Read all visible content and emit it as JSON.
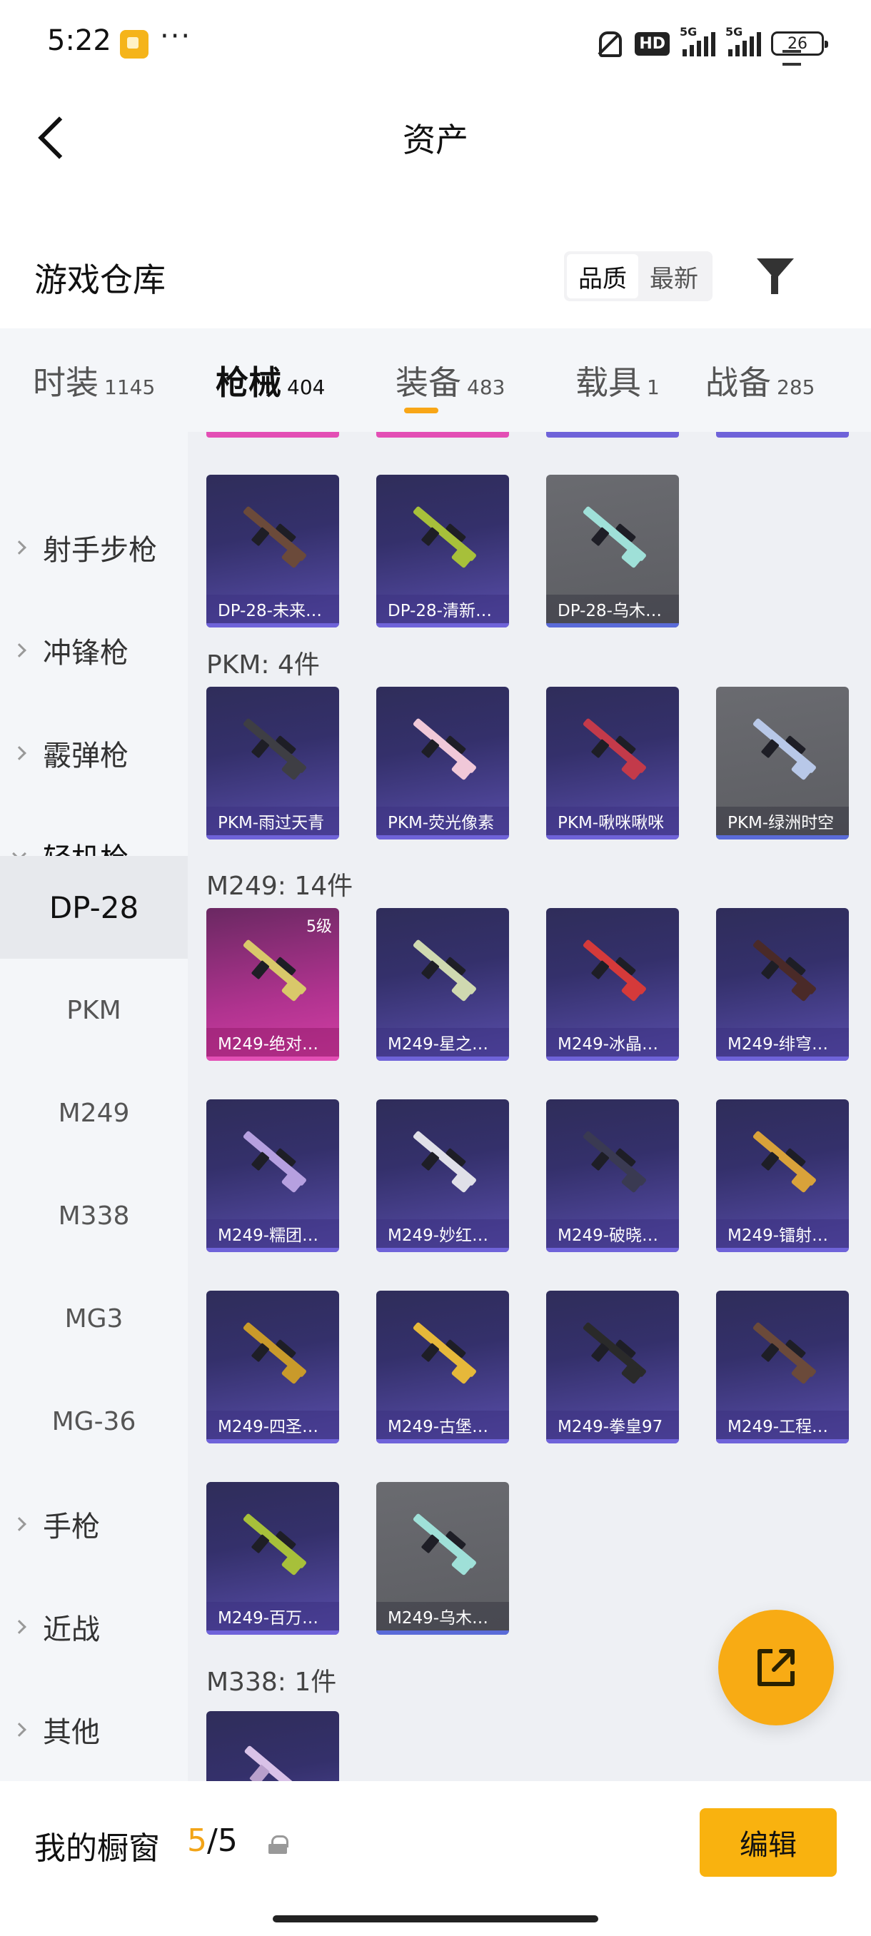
{
  "status": {
    "time": "5:22",
    "more": "···",
    "hd": "HD",
    "net1": "5G",
    "net2": "5G",
    "battery": "26"
  },
  "header": {
    "title": "资产"
  },
  "warehouse": {
    "title": "游戏仓库",
    "sort_quality": "品质",
    "sort_newest": "最新"
  },
  "categories": [
    {
      "label": "时装",
      "count": "1145"
    },
    {
      "label": "枪械",
      "count": "404",
      "active": true
    },
    {
      "label": "装备",
      "count": "483"
    },
    {
      "label": "载具",
      "count": "1"
    },
    {
      "label": "战备",
      "count": "285"
    }
  ],
  "sidebar": {
    "groups": [
      {
        "label": "射手步枪"
      },
      {
        "label": "冲锋枪"
      },
      {
        "label": "霰弹枪"
      },
      {
        "label": "轻机枪",
        "expanded": true
      },
      {
        "label": "手枪"
      },
      {
        "label": "近战"
      },
      {
        "label": "其他"
      }
    ],
    "subitems": [
      "DP-28",
      "PKM",
      "M249",
      "M338",
      "MG3",
      "MG-36"
    ],
    "active_sub": "DP-28"
  },
  "content": {
    "dp28_items": [
      {
        "name": "DP-28-未来…",
        "style": "purple"
      },
      {
        "name": "DP-28-清新…",
        "style": "purple"
      },
      {
        "name": "DP-28-乌木…",
        "style": "gray"
      }
    ],
    "pkm_label": "PKM: 4件",
    "pkm_items": [
      {
        "name": "PKM-雨过天青",
        "style": "purple"
      },
      {
        "name": "PKM-荧光像素",
        "style": "purple"
      },
      {
        "name": "PKM-啾咪啾咪",
        "style": "purple"
      },
      {
        "name": "PKM-绿洲时空",
        "style": "gray"
      }
    ],
    "m249_label": "M249: 14件",
    "m249_items": [
      {
        "name": "M249-绝对…",
        "style": "pink",
        "level": "5级"
      },
      {
        "name": "M249-星之…",
        "style": "purple"
      },
      {
        "name": "M249-冰晶…",
        "style": "purple"
      },
      {
        "name": "M249-绯穹…",
        "style": "purple"
      },
      {
        "name": "M249-糯团…",
        "style": "purple"
      },
      {
        "name": "M249-妙红…",
        "style": "purple"
      },
      {
        "name": "M249-破晓…",
        "style": "purple"
      },
      {
        "name": "M249-镭射…",
        "style": "purple"
      },
      {
        "name": "M249-四圣…",
        "style": "purple"
      },
      {
        "name": "M249-古堡…",
        "style": "purple"
      },
      {
        "name": "M249-拳皇97",
        "style": "purple"
      },
      {
        "name": "M249-工程…",
        "style": "purple"
      },
      {
        "name": "M249-百万…",
        "style": "purple"
      },
      {
        "name": "M249-乌木…",
        "style": "gray"
      }
    ],
    "m338_label": "M338: 1件"
  },
  "bottom": {
    "showcase_label": "我的橱窗",
    "showcase_current": "5",
    "showcase_total": "/5",
    "edit_label": "编辑"
  },
  "colors": {
    "accent": "#f9b20f",
    "card_purple": "#34306b",
    "card_pink": "#b0338f",
    "card_gray": "#5c5d62"
  }
}
